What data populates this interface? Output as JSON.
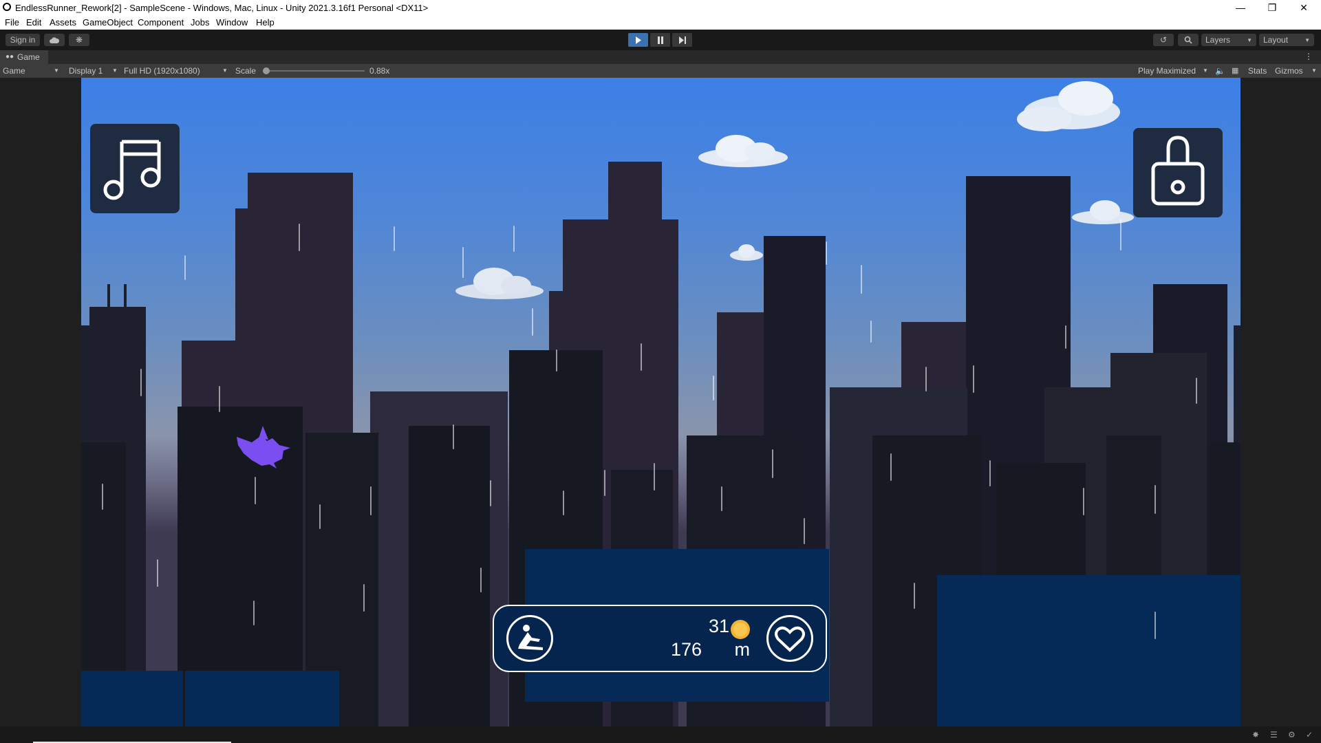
{
  "window": {
    "title": "EndlessRunner_Rework[2] - SampleScene - Windows, Mac, Linux - Unity 2021.3.16f1 Personal <DX11>",
    "minimize_icon": "minimize-icon",
    "restore_icon": "restore-icon",
    "close_icon": "close-icon"
  },
  "menu": [
    "File",
    "Edit",
    "Assets",
    "GameObject",
    "Component",
    "Jobs",
    "Window",
    "Help"
  ],
  "toolbar": {
    "sign_in": "Sign in",
    "layers": "Layers",
    "layout": "Layout",
    "play_active_color": "#3a72b0"
  },
  "tab": {
    "label": "Game"
  },
  "game_toolbar": {
    "mode": "Game",
    "display": "Display 1",
    "resolution": "Full HD (1920x1080)",
    "scale_label": "Scale",
    "scale_value": "0.88x",
    "play_mode": "Play Maximized",
    "stats": "Stats",
    "gizmos": "Gizmos"
  },
  "hud": {
    "coins": "31",
    "distance": "176",
    "distance_unit": "m",
    "left_icon": "music-icon",
    "right_icon": "lock-icon",
    "coin_color": "#f2b233",
    "bird_color": "#7a4ef0"
  }
}
